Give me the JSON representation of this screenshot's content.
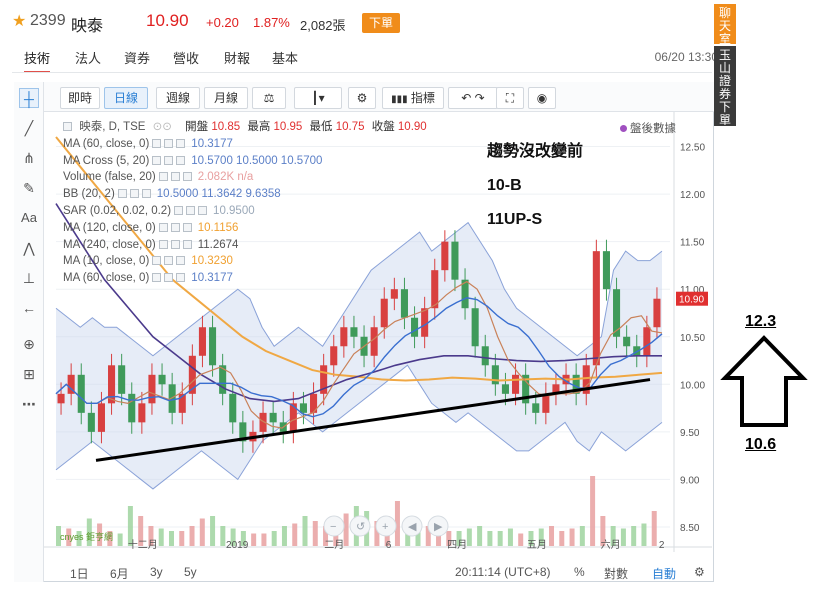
{
  "ticker": {
    "code": "2399",
    "name": "映泰",
    "price": "10.90",
    "change": "+0.20",
    "change_pct": "1.87%",
    "volume": "2,082張",
    "order_button": "下單"
  },
  "side_buttons": {
    "chat": "聊天室",
    "yushan": "玉山證券下單"
  },
  "tabs": [
    "技術",
    "法人",
    "資券",
    "營收",
    "財報",
    "基本"
  ],
  "datetime": "06/20 13:30",
  "toolbar": {
    "intraday": "即時",
    "daily": "日線",
    "weekly": "週線",
    "monthly": "月線",
    "indicators": "指標"
  },
  "legend": {
    "main": {
      "name": "映泰, D, TSE",
      "open_label": "開盤",
      "open": "10.85",
      "high_label": "最高",
      "high": "10.95",
      "low_label": "最低",
      "low": "10.75",
      "close_label": "收盤",
      "close": "10.90"
    },
    "rows": [
      {
        "name": "MA (60, close, 0)",
        "values": "10.3177",
        "color": "#5b7fc7"
      },
      {
        "name": "MA Cross (5, 20)",
        "values": "10.5700  10.5000  10.5700",
        "color": "#5b7fc7"
      },
      {
        "name": "Volume (false, 20)",
        "values": "2.082K  n/a",
        "color": "#e8a0a0"
      },
      {
        "name": "BB (20, 2)",
        "values": "10.5000  11.3642  9.6358",
        "color": "#5b7fc7"
      },
      {
        "name": "SAR (0.02, 0.02, 0.2)",
        "values": "10.9500",
        "color": "#9aa8b8"
      },
      {
        "name": "MA (120, close, 0)",
        "values": "10.1156",
        "color": "#f0a030"
      },
      {
        "name": "MA (240, close, 0)",
        "values": "11.2674",
        "color": "#555555"
      },
      {
        "name": "MA (10, close, 0)",
        "values": "10.3230",
        "color": "#f0a030"
      },
      {
        "name": "MA (60, close, 0)",
        "values": "10.3177",
        "color": "#5b7fc7"
      }
    ]
  },
  "after_hours": "盤後數據",
  "annotation": {
    "line1": "趨勢沒改變前",
    "line2": "10-B",
    "line3": "11UP-S"
  },
  "right_annotation": {
    "top": "12.3",
    "bottom": "10.6"
  },
  "price_axis": [
    "12.50",
    "12.00",
    "11.50",
    "11.00",
    "10.50",
    "10.00",
    "9.50",
    "9.00",
    "8.50"
  ],
  "current_price_tag": "10.90",
  "time_axis": [
    "十二月",
    "2019",
    "二月",
    "6",
    "四月",
    "五月",
    "六月",
    "2"
  ],
  "bottom_bar": {
    "ranges": [
      "1日",
      "6月",
      "3y",
      "5y"
    ],
    "clock": "20:11:14 (UTC+8)",
    "percent": "%",
    "log": "對數",
    "auto": "自動"
  },
  "watermark": "cnyes 鉅亨網",
  "chart_data": {
    "type": "candlestick",
    "yrange": [
      8.3,
      12.8
    ],
    "close_series": [
      9.9,
      10.1,
      9.7,
      9.5,
      9.8,
      10.2,
      9.9,
      9.6,
      9.8,
      10.1,
      10.0,
      9.7,
      9.9,
      10.3,
      10.6,
      10.2,
      9.9,
      9.6,
      9.4,
      9.5,
      9.7,
      9.6,
      9.5,
      9.8,
      9.7,
      9.9,
      10.2,
      10.4,
      10.6,
      10.5,
      10.3,
      10.6,
      10.9,
      11.0,
      10.7,
      10.5,
      10.8,
      11.2,
      11.5,
      11.1,
      10.8,
      10.4,
      10.2,
      10.0,
      9.9,
      10.1,
      9.8,
      9.7,
      9.9,
      10.0,
      10.1,
      9.9,
      10.2,
      11.4,
      11.0,
      10.5,
      10.4,
      10.3,
      10.6,
      10.9
    ],
    "bb_upper": [
      10.8,
      10.7,
      10.6,
      10.7,
      10.6,
      10.6,
      10.5,
      10.4,
      10.3,
      10.4,
      10.5,
      10.6,
      10.7,
      10.8,
      10.9,
      11.0,
      10.9,
      10.6,
      10.4,
      10.5,
      10.6,
      10.5,
      10.4,
      10.6,
      10.8,
      11.0,
      11.2,
      11.3,
      11.4,
      11.5,
      11.6,
      11.4,
      11.5,
      11.6,
      11.7,
      11.5,
      11.3,
      11.0,
      10.8,
      10.7,
      10.6,
      10.5,
      10.4,
      10.3,
      10.4,
      10.5,
      11.2,
      11.4,
      11.3,
      11.3,
      11.4
    ],
    "bb_lower": [
      9.1,
      9.2,
      9.3,
      9.4,
      9.3,
      9.2,
      9.1,
      9.0,
      8.9,
      9.0,
      9.1,
      9.2,
      9.3,
      9.2,
      9.1,
      9.0,
      9.2,
      9.4,
      9.5,
      9.6,
      9.7,
      9.6,
      9.5,
      9.6,
      9.7,
      9.8,
      9.9,
      10.0,
      10.1,
      10.2,
      10.0,
      9.8,
      9.7,
      9.6,
      9.7,
      9.6,
      9.5,
      9.4,
      9.3,
      9.3,
      9.4,
      9.5,
      9.6,
      9.4,
      9.3,
      9.5,
      9.4,
      9.3,
      9.4,
      9.5,
      9.6
    ],
    "ma120": [
      12.6,
      12.3,
      12.0,
      11.7,
      11.4,
      11.1,
      10.9,
      10.7,
      10.5,
      10.35,
      10.25,
      10.15,
      10.1,
      10.08,
      10.05,
      10.04,
      10.05,
      10.07,
      10.06,
      10.04,
      10.05,
      10.06,
      10.05,
      10.07,
      10.08,
      10.1,
      10.12
    ],
    "ma240": [
      11.9,
      11.5,
      11.1,
      10.8,
      10.5,
      10.3,
      10.1,
      9.95,
      9.85,
      9.82,
      9.85,
      9.95,
      10.05,
      10.12,
      10.2,
      10.26,
      10.3,
      10.3,
      10.27,
      10.25,
      10.24,
      10.25,
      10.27,
      10.29,
      10.3,
      10.3
    ],
    "trendline": {
      "start": [
        0.0,
        9.2
      ],
      "end": [
        1.0,
        10.05
      ]
    },
    "volume": [
      40,
      35,
      30,
      55,
      45,
      30,
      25,
      80,
      60,
      40,
      35,
      30,
      30,
      40,
      55,
      60,
      40,
      35,
      30,
      25,
      25,
      30,
      40,
      45,
      60,
      50,
      40,
      35,
      65,
      80,
      70,
      50,
      60,
      90,
      55,
      45,
      40,
      35,
      30,
      30,
      35,
      40,
      30,
      30,
      35,
      25,
      30,
      35,
      40,
      30,
      35,
      40,
      140,
      60,
      40,
      35,
      40,
      45,
      70
    ]
  }
}
